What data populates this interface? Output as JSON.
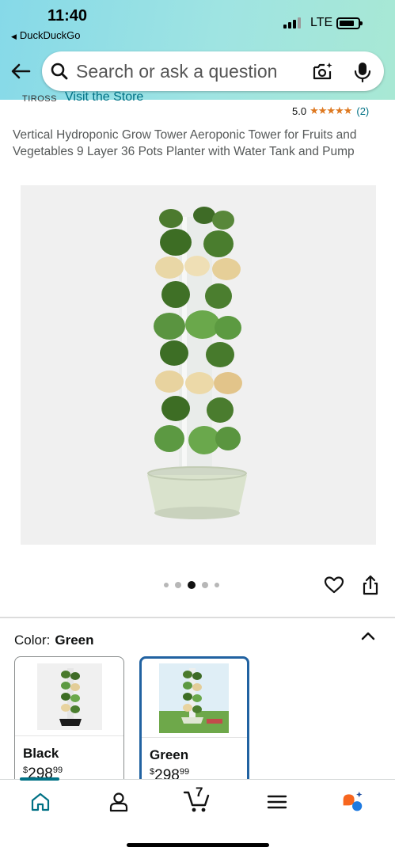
{
  "status_bar": {
    "time": "11:40",
    "back_app": "DuckDuckGo",
    "network": "LTE"
  },
  "search": {
    "placeholder": "Search or ask a question"
  },
  "product": {
    "brand_partial": "TIROSS",
    "visit_store": "Visit the Store",
    "rating_value": "5.0",
    "rating_stars": "★★★★★",
    "rating_count": "(2)",
    "title": "Vertical Hydroponic Grow Tower Aeroponic Tower for Fruits and Vegetables 9 Layer 36 Pots Planter with Water Tank and Pump",
    "image_carousel": {
      "total": 5,
      "active_index": 2
    }
  },
  "color_selector": {
    "label": "Color:",
    "selected": "Green",
    "options": [
      {
        "name": "Black",
        "currency": "$",
        "price_whole": "298",
        "price_fraction": "99",
        "selected": false
      },
      {
        "name": "Green",
        "currency": "$",
        "price_whole": "298",
        "price_fraction": "99",
        "selected": true
      }
    ]
  },
  "bottom_nav": {
    "cart_count": "7",
    "items": [
      "home-icon",
      "account-icon",
      "cart-icon",
      "menu-icon",
      "rufus-icon"
    ],
    "active": "home-icon"
  },
  "colors": {
    "link": "#007185",
    "star": "#de7921",
    "selected_border": "#2162a1",
    "header_start": "#86d9e8",
    "header_end": "#a8e8d4"
  }
}
